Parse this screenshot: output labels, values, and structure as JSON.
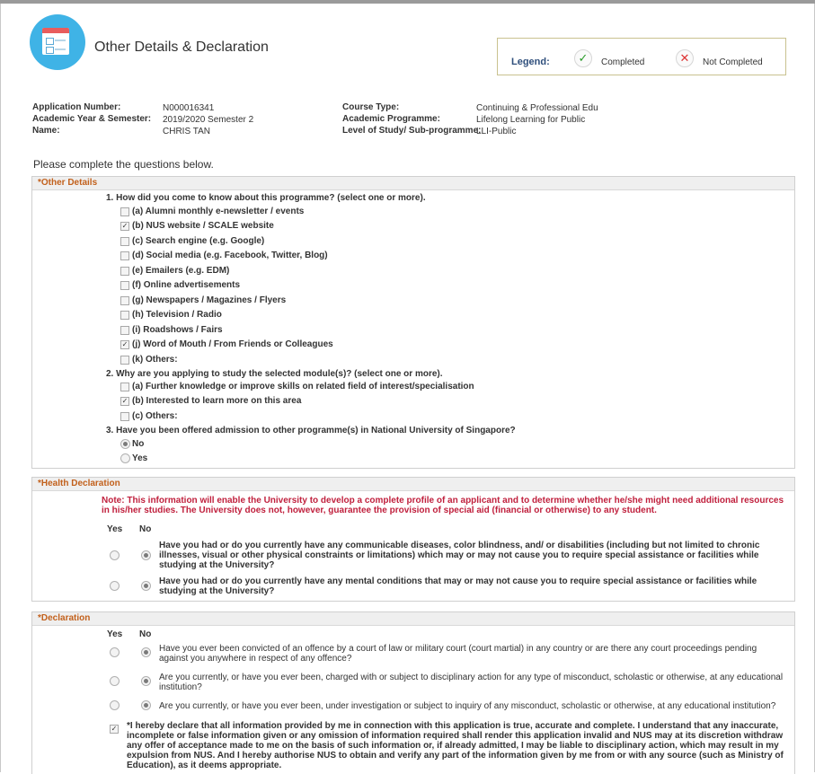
{
  "page": {
    "title": "Other Details & Declaration",
    "legend": {
      "label": "Legend:",
      "completed": "Completed",
      "not_completed": "Not Completed"
    }
  },
  "info": {
    "app_no_label": "Application Number:",
    "app_no": "N000016341",
    "year_label": "Academic Year & Semester:",
    "year": "2019/2020 Semester 2",
    "name_label": "Name:",
    "name": "CHRIS TAN",
    "course_label": "Course Type:",
    "course": "Continuing & Professional Edu",
    "prog_label": "Academic Programme:",
    "prog": "Lifelong Learning for Public",
    "level_label": "Level of Study/ Sub-programme:",
    "level": "LLI-Public"
  },
  "instruction": "Please complete the questions below.",
  "other_details": {
    "header": "*Other Details",
    "q1": "1. How did you come to know about this programme? (select one or more).",
    "q1_options": [
      {
        "label": "(a) Alumni monthly e-newsletter / events",
        "checked": false
      },
      {
        "label": "(b) NUS website / SCALE website",
        "checked": true
      },
      {
        "label": "(c) Search engine (e.g. Google)",
        "checked": false
      },
      {
        "label": "(d) Social media (e.g. Facebook, Twitter, Blog)",
        "checked": false
      },
      {
        "label": "(e) Emailers (e.g. EDM)",
        "checked": false
      },
      {
        "label": "(f) Online advertisements",
        "checked": false
      },
      {
        "label": "(g) Newspapers / Magazines / Flyers",
        "checked": false
      },
      {
        "label": "(h) Television / Radio",
        "checked": false
      },
      {
        "label": "(i) Roadshows / Fairs",
        "checked": false
      },
      {
        "label": "(j) Word of Mouth / From Friends or Colleagues",
        "checked": true
      },
      {
        "label": "(k) Others:",
        "checked": false
      }
    ],
    "q2": "2. Why are you applying to study the selected module(s)? (select one or more).",
    "q2_options": [
      {
        "label": "(a) Further knowledge or improve skills on related field of interest/specialisation",
        "checked": false
      },
      {
        "label": "(b) Interested to learn more on this area",
        "checked": true
      },
      {
        "label": "(c) Others:",
        "checked": false
      }
    ],
    "q3": "3. Have you been offered admission to other programme(s) in National University of Singapore?",
    "q3_no": "No",
    "q3_yes": "Yes",
    "q3_selected": "No"
  },
  "health": {
    "header": "*Health Declaration",
    "note": "Note: This information will enable the University to develop a complete profile of an applicant and to determine whether he/she might need additional resources in his/her studies. The University does not, however, guarantee the provision of special aid (financial or otherwise) to any student.",
    "yes": "Yes",
    "no": "No",
    "q1": "Have you had or do you currently have any communicable diseases, color blindness, and/ or disabilities (including but not limited to chronic illnesses, visual or other physical constraints or limitations) which may or may not cause you to require special assistance or facilities while studying at the University?",
    "q1_answer": "No",
    "q2": "Have you had or do you currently have any mental conditions that may or may not cause you to require special assistance or facilities while studying at the University?",
    "q2_answer": "No"
  },
  "declaration": {
    "header": "*Declaration",
    "yes": "Yes",
    "no": "No",
    "q1": "Have you ever been convicted of an offence by a court of law or military court (court martial) in any country or are there any court proceedings pending against you anywhere in respect of any offence?",
    "q1_answer": "No",
    "q2": "Are you currently, or have you ever been, charged with or subject to disciplinary action for any type of misconduct, scholastic or otherwise, at any educational institution?",
    "q2_answer": "No",
    "q3": "Are you currently, or have you ever been, under investigation or subject to inquiry of any misconduct, scholastic or otherwise, at any educational institution?",
    "q3_answer": "No",
    "statement": "*I hereby declare that all information provided by me in connection with this application is true, accurate and complete. I understand that any inaccurate, incomplete or false information given or any omission of information required shall render this application invalid and NUS may at its discretion withdraw any offer of acceptance made to me on the basis of such information or, if already admitted, I may be liable to disciplinary action, which may result in my expulsion from NUS. And I hereby authorise NUS to obtain and verify any part of the information given by me from or with any source (such as Ministry of Education), as it deems appropriate.",
    "statement_checked": true
  }
}
